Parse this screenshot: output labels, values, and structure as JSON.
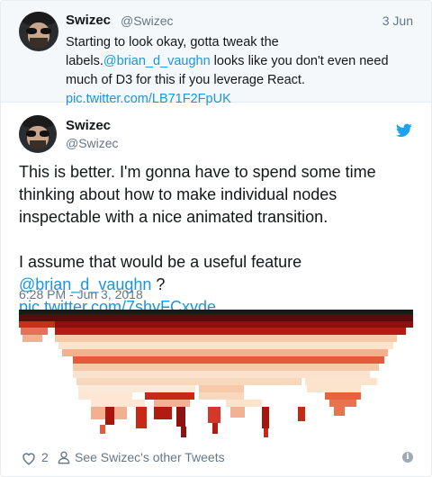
{
  "parent_tweet": {
    "name": "Swizec",
    "handle": "@Swizec",
    "date": "3 Jun",
    "text_before": "Starting to look okay, gotta tweak the labels.",
    "mention": "@brian_d_vaughn",
    "text_after": " looks like you don't even need much of D3 for this if you leverage React. ",
    "link": "pic.twitter.com/LB71F2FpUK"
  },
  "main_tweet": {
    "name": "Swizec",
    "handle": "@Swizec",
    "paragraph1": "This is better. I'm gonna have to spend some time thinking about how to make individual nodes inspectable with a nice animated transition.",
    "paragraph2_before": "I assume that would be a useful feature ",
    "mention": "@brian_d_vaughn",
    "paragraph2_after": " ?",
    "link": "pic.twitter.com/7shyFCxyde",
    "timestamp": "6:28 PM - Jun 3, 2018"
  },
  "footer": {
    "like_count": "2",
    "other_tweets_label": "See Swizec's other Tweets",
    "info_glyph": "i"
  },
  "icons": {
    "heart": "heart-icon",
    "person": "person-icon",
    "bird": "twitter-bird-icon",
    "info": "info-icon"
  },
  "colors": {
    "link": "#1b95e0",
    "muted": "#657786",
    "parent_bg": "#f5f8fa"
  }
}
